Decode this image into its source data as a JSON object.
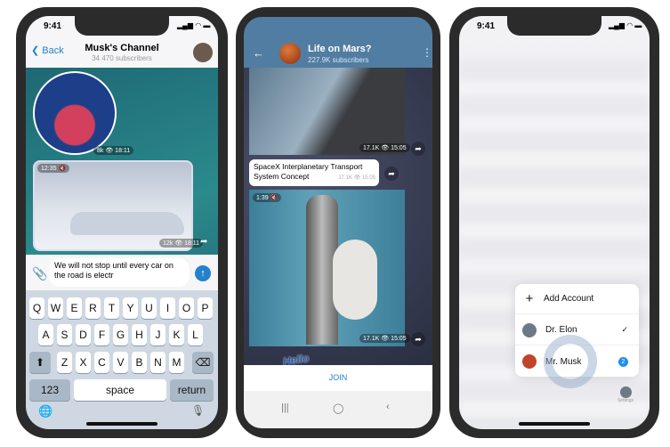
{
  "phone1": {
    "time": "9:41",
    "back": "Back",
    "title": "Musk's Channel",
    "subtitle": "34 470 subscribers",
    "sticker_meta": "8k 👁 18:11",
    "video_duration": "12:35 🔇",
    "video_meta": "12k 👁 18:11",
    "input_text": "We will not stop until every car on the road is electr",
    "keyboard": {
      "row1": [
        "Q",
        "W",
        "E",
        "R",
        "T",
        "Y",
        "U",
        "I",
        "O",
        "P"
      ],
      "row2": [
        "A",
        "S",
        "D",
        "F",
        "G",
        "H",
        "J",
        "K",
        "L"
      ],
      "row3": [
        "Z",
        "X",
        "C",
        "V",
        "B",
        "N",
        "M"
      ],
      "numbers": "123",
      "space": "space",
      "return": "return"
    }
  },
  "phone2": {
    "title": "Life on Mars?",
    "subtitle": "227.9K subscribers",
    "video1_meta": "17.1K 👁 15:05",
    "message": "SpaceX Interplanetary Transport System Concept",
    "message_meta": "17.1K 👁 15:05",
    "video2_duration": "1:39 🔇",
    "video2_meta": "17.1K 👁 15:05",
    "sticker_text": "Hello",
    "join": "JOIN"
  },
  "phone3": {
    "time": "9:41",
    "menu": {
      "add_account": "Add Account",
      "accounts": [
        {
          "name": "Dr. Elon",
          "selected": true
        },
        {
          "name": "Mr. Musk",
          "badge": "2"
        }
      ]
    },
    "settings": "Settings"
  },
  "colors": {
    "accent": "#2481cc",
    "header2": "#517da2"
  }
}
